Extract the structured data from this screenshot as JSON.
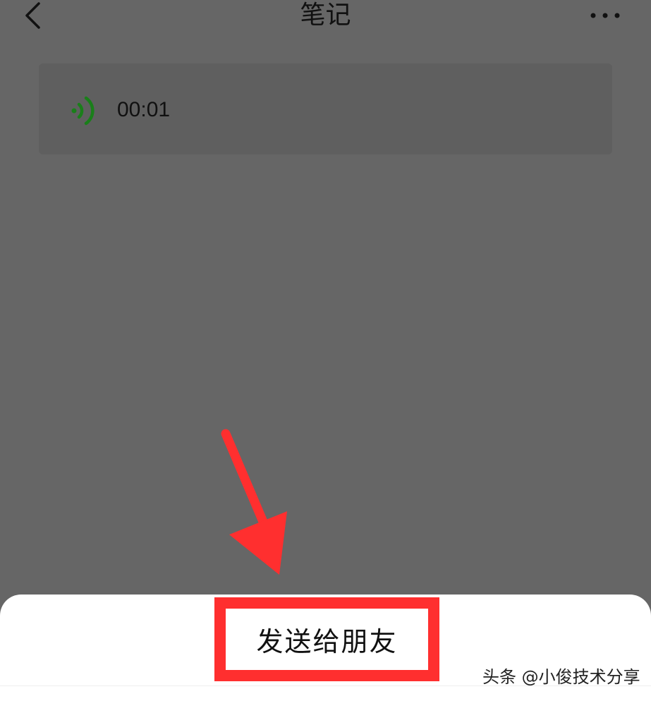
{
  "header": {
    "title": "笔记",
    "back_icon": "chevron-left-icon",
    "more_icon": "more-horizontal-icon"
  },
  "voice_note": {
    "icon": "voice-wave-icon",
    "duration": "00:01",
    "icon_color": "#1a7f1a"
  },
  "annotation": {
    "arrow_color": "#ff2f2f",
    "highlight_color": "#ff2f2f"
  },
  "bottom_sheet": {
    "send_label": "发送给朋友"
  },
  "watermark": "头条 @小俊技术分享"
}
